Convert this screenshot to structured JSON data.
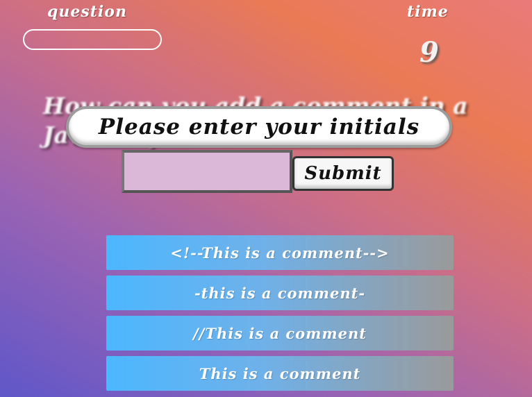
{
  "header": {
    "question_label": "Question",
    "time_label": "Time",
    "timer_value": "9"
  },
  "quiz": {
    "question": "How can you add a comment in a JavaScript?",
    "answers": [
      "<!--This is a comment-->",
      "-this is a comment-",
      "//This is a comment",
      "This is a comment"
    ]
  },
  "modal": {
    "title": "Please enter your initials",
    "input_value": "",
    "submit_label": "Submit"
  },
  "colors": {
    "answer_button": "#4cb7ff",
    "modal_background": "#ffffff",
    "input_background": "#dbb8d8"
  }
}
